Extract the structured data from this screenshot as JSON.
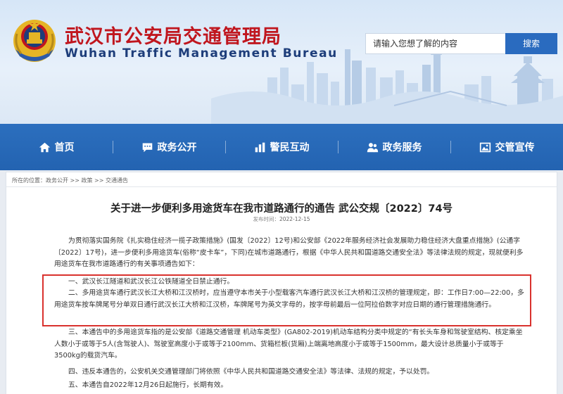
{
  "header": {
    "title_cn": "武汉市公安局交通管理局",
    "title_en": "Wuhan Traffic Management Bureau",
    "search_placeholder": "请输入您想了解的内容",
    "search_button": "搜索"
  },
  "nav": [
    {
      "label": "首页",
      "icon": "home-icon"
    },
    {
      "label": "政务公开",
      "icon": "chat-icon"
    },
    {
      "label": "警民互动",
      "icon": "chart-icon"
    },
    {
      "label": "政务服务",
      "icon": "people-icon"
    },
    {
      "label": "交管宣传",
      "icon": "gallery-icon"
    }
  ],
  "breadcrumb": {
    "prefix": "所在的位置：",
    "items": [
      "政务公开",
      "政策",
      "交通通告"
    ],
    "separator": " >> "
  },
  "article": {
    "title": "关于进一步便利多用途货车在我市道路通行的通告 武公交规〔2022〕74号",
    "date_label": "发布时间：",
    "date": "2022-12-15",
    "paragraphs": [
      "为贯彻落实国务院《扎实稳住经济一揽子政策措施》(国发〔2022〕12号)和公安部《2022年服务经济社会发展助力稳住经济大盘重点措施》(公通字〔2022〕17号)，进一步便利多用途货车(俗称“皮卡车”，下同)在城市道路通行，根据《中华人民共和国道路交通安全法》等法律法规的规定，现就便利多用途货车在我市道路通行的有关事项通告如下：",
      "一、武汉长江隧道和武汉长江公铁隧道全日禁止通行。",
      "二、多用途货车通行武汉长江大桥和江汉桥时，应当遵守本市关于小型载客汽车通行武汉长江大桥和江汉桥的管理规定，即：工作日7:00—22:00，多用途货车按车牌尾号分单双日通行武汉长江大桥和江汉桥，车牌尾号为英文字母的，按字母前最后一位阿拉伯数字对应日期的通行管理措施通行。",
      "三、本通告中的多用途货车指的是公安部《道路交通管理 机动车类型》(GA802-2019)机动车结构分类中规定的“有长头车身和驾驶室结构、核定乘坐人数小于或等于5人(含驾驶人)、驾驶室高度小于或等于2100mm、货箱栏板(货厢)上端离地高度小于或等于1500mm，最大设计总质量小于或等于3500kg的载货汽车。",
      "四、违反本通告的，公安机关交通管理部门将依照《中华人民共和国道路交通安全法》等法律、法规的规定，予以处罚。",
      "五、本通告自2022年12月26日起施行，长期有效。"
    ]
  },
  "colors": {
    "title_red": "#c0161e",
    "nav_blue": "#2a6bbf",
    "highlight_red": "#d9322e"
  }
}
